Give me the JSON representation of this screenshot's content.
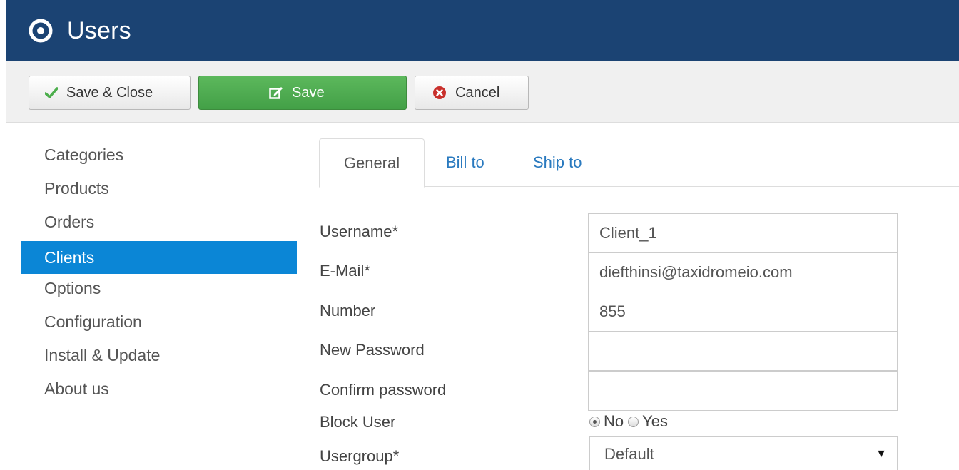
{
  "header": {
    "title": "Users"
  },
  "toolbar": {
    "save_close_label": "Save & Close",
    "save_label": "Save",
    "cancel_label": "Cancel"
  },
  "sidebar": {
    "items": [
      {
        "label": "Categories"
      },
      {
        "label": "Products"
      },
      {
        "label": "Orders"
      },
      {
        "label": "Clients",
        "active": true
      },
      {
        "label": "Options"
      },
      {
        "label": "Configuration"
      },
      {
        "label": "Install & Update"
      },
      {
        "label": "About us"
      }
    ]
  },
  "tabs": [
    {
      "label": "General",
      "active": true
    },
    {
      "label": "Bill to"
    },
    {
      "label": "Ship to"
    }
  ],
  "form": {
    "username": {
      "label": "Username*",
      "value": "Client_1"
    },
    "email": {
      "label": "E-Mail*",
      "value": "diefthinsi@taxidromeio.com"
    },
    "number": {
      "label": "Number",
      "value": "855"
    },
    "new_password": {
      "label": "New Password",
      "value": ""
    },
    "confirm_password": {
      "label": "Confirm password",
      "value": ""
    },
    "block_user": {
      "label": "Block User",
      "options": [
        "No",
        "Yes"
      ],
      "selected": "No"
    },
    "usergroup": {
      "label": "Usergroup*",
      "value": "Default"
    }
  },
  "colors": {
    "header_bg": "#1b4373",
    "save_green": "#5cb85c",
    "sidebar_active": "#0b86d6",
    "tab_link": "#2a7abf",
    "cancel_red": "#c9302c"
  },
  "icons": {
    "header": "joomla-target-icon",
    "save_close": "checkmark-icon",
    "save": "edit-icon",
    "cancel": "cancel-circle-icon",
    "select": "caret-down-icon"
  }
}
